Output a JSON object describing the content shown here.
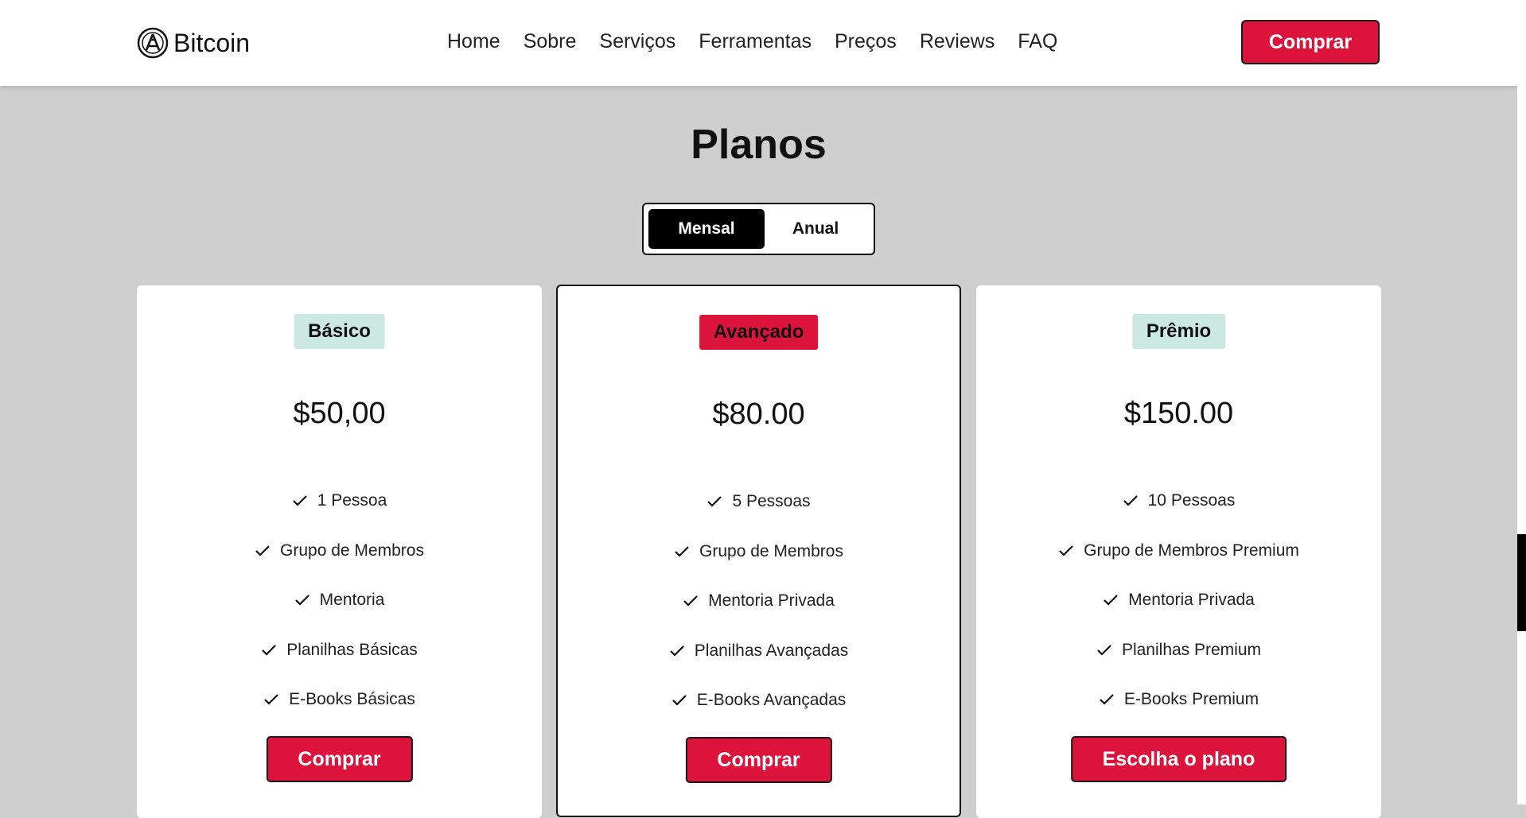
{
  "header": {
    "logo_text": "Bitcoin",
    "nav": [
      "Home",
      "Sobre",
      "Serviços",
      "Ferramentas",
      "Preços",
      "Reviews",
      "FAQ"
    ],
    "cta_label": "Comprar"
  },
  "section": {
    "title": "Planos",
    "toggle": {
      "active": "Mensal",
      "inactive": "Anual"
    }
  },
  "plans": [
    {
      "badge": "Básico",
      "price": "$50,00",
      "features": [
        "1 Pessoa",
        "Grupo de Membros",
        "Mentoria",
        "Planilhas Básicas",
        "E-Books Básicas"
      ],
      "button": "Comprar"
    },
    {
      "badge": "Avançado",
      "price": "$80.00",
      "features": [
        "5 Pessoas",
        "Grupo de Membros",
        "Mentoria Privada",
        "Planilhas Avançadas",
        "E-Books Avançadas"
      ],
      "button": "Comprar"
    },
    {
      "badge": "Prêmio",
      "price": "$150.00",
      "features": [
        "10 Pessoas",
        "Grupo de Membros Premium",
        "Mentoria Privada",
        "Planilhas Premium",
        "E-Books Premium"
      ],
      "button": "Escolha o plano"
    }
  ],
  "colors": {
    "accent": "#dc143c",
    "badge_teal": "#cce8e3",
    "background": "#cfcfcf"
  },
  "icons": {
    "logo": "bitcoin-logo-icon",
    "feature": "check-icon"
  }
}
